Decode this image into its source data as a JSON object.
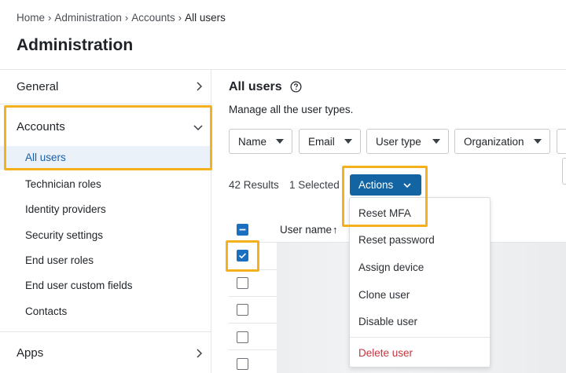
{
  "breadcrumb": {
    "items": [
      "Home",
      "Administration",
      "Accounts",
      "All users"
    ]
  },
  "page": {
    "title": "Administration"
  },
  "sidebar": {
    "general_label": "General",
    "accounts_label": "Accounts",
    "accounts_items": [
      "All users",
      "Technician roles",
      "Identity providers",
      "Security settings",
      "End user roles",
      "End user custom fields",
      "Contacts"
    ],
    "apps_label": "Apps"
  },
  "main": {
    "title": "All users",
    "description": "Manage all the user types.",
    "filters": [
      "Name",
      "Email",
      "User type",
      "Organization"
    ],
    "results": "42 Results",
    "selected": "1 Selected",
    "actions_label": "Actions",
    "actions_menu": [
      "Reset MFA",
      "Reset password",
      "Assign device",
      "Clone user",
      "Disable user"
    ],
    "actions_menu_danger": "Delete user",
    "table": {
      "col_user_name": "User name",
      "sort_arrow": "↑"
    }
  },
  "colors": {
    "accent": "#1264a3",
    "highlight": "#f5b11b",
    "danger": "#c8333d"
  }
}
